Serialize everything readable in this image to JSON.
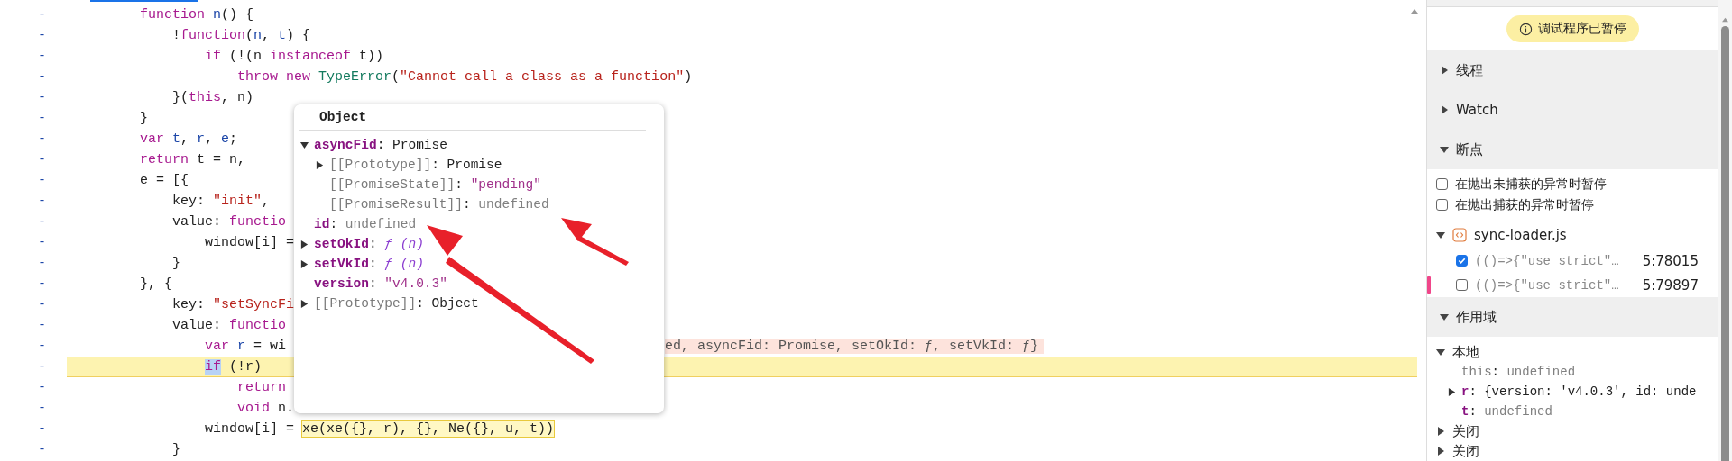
{
  "editor": {
    "lines": [
      {
        "gutter": "-",
        "paused": false,
        "tokens": [
          {
            "kind": "keyword",
            "text": "        function "
          },
          {
            "kind": "name",
            "text": "n"
          },
          {
            "kind": "plain",
            "text": "() {"
          }
        ]
      },
      {
        "gutter": "-",
        "paused": false,
        "tokens": [
          {
            "kind": "plain",
            "text": "            !"
          },
          {
            "kind": "keyword",
            "text": "function"
          },
          {
            "kind": "plain",
            "text": "("
          },
          {
            "kind": "name",
            "text": "n"
          },
          {
            "kind": "plain",
            "text": ", "
          },
          {
            "kind": "name",
            "text": "t"
          },
          {
            "kind": "plain",
            "text": ") {"
          }
        ]
      },
      {
        "gutter": "-",
        "paused": false,
        "tokens": [
          {
            "kind": "keyword",
            "text": "                if"
          },
          {
            "kind": "plain",
            "text": " (!(n "
          },
          {
            "kind": "keyword",
            "text": "instanceof"
          },
          {
            "kind": "plain",
            "text": " t))"
          }
        ]
      },
      {
        "gutter": "-",
        "paused": false,
        "tokens": [
          {
            "kind": "keyword",
            "text": "                    throw new "
          },
          {
            "kind": "type",
            "text": "TypeError"
          },
          {
            "kind": "plain",
            "text": "("
          },
          {
            "kind": "string",
            "text": "\"Cannot call a class as a function\""
          },
          {
            "kind": "plain",
            "text": ")"
          }
        ]
      },
      {
        "gutter": "-",
        "paused": false,
        "tokens": [
          {
            "kind": "plain",
            "text": "            }("
          },
          {
            "kind": "keyword",
            "text": "this"
          },
          {
            "kind": "plain",
            "text": ", n)"
          }
        ]
      },
      {
        "gutter": "-",
        "paused": false,
        "tokens": [
          {
            "kind": "plain",
            "text": "        }"
          }
        ]
      },
      {
        "gutter": "-",
        "paused": false,
        "tokens": [
          {
            "kind": "keyword",
            "text": "        var "
          },
          {
            "kind": "name",
            "text": "t"
          },
          {
            "kind": "plain",
            "text": ", "
          },
          {
            "kind": "name",
            "text": "r"
          },
          {
            "kind": "plain",
            "text": ", "
          },
          {
            "kind": "name",
            "text": "e"
          },
          {
            "kind": "plain",
            "text": ";"
          }
        ]
      },
      {
        "gutter": "-",
        "paused": false,
        "tokens": [
          {
            "kind": "keyword",
            "text": "        return"
          },
          {
            "kind": "plain",
            "text": " t = n,"
          }
        ]
      },
      {
        "gutter": "-",
        "paused": false,
        "tokens": [
          {
            "kind": "plain",
            "text": "        e = [{"
          }
        ]
      },
      {
        "gutter": "-",
        "paused": false,
        "tokens": [
          {
            "kind": "plain",
            "text": "            key: "
          },
          {
            "kind": "string",
            "text": "\"init\""
          },
          {
            "kind": "plain",
            "text": ","
          }
        ]
      },
      {
        "gutter": "-",
        "paused": false,
        "tokens": [
          {
            "kind": "plain",
            "text": "            value: "
          },
          {
            "kind": "keyword",
            "text": "functio"
          }
        ]
      },
      {
        "gutter": "-",
        "paused": false,
        "tokens": [
          {
            "kind": "plain",
            "text": "                window[i] ="
          }
        ]
      },
      {
        "gutter": "-",
        "paused": false,
        "tokens": [
          {
            "kind": "plain",
            "text": "            }"
          }
        ]
      },
      {
        "gutter": "-",
        "paused": false,
        "tokens": [
          {
            "kind": "plain",
            "text": "        }, {"
          }
        ]
      },
      {
        "gutter": "-",
        "paused": false,
        "tokens": [
          {
            "kind": "plain",
            "text": "            key: "
          },
          {
            "kind": "string",
            "text": "\"setSyncFi"
          }
        ]
      },
      {
        "gutter": "-",
        "paused": false,
        "tokens": [
          {
            "kind": "plain",
            "text": "            value: "
          },
          {
            "kind": "keyword",
            "text": "functio"
          }
        ]
      },
      {
        "gutter": "-",
        "paused": false,
        "tokens": [
          {
            "kind": "keyword",
            "text": "                var "
          },
          {
            "kind": "name",
            "text": "r"
          },
          {
            "kind": "plain",
            "text": " = wi"
          }
        ],
        "inline_value": "ed, asyncFid: Promise, setOkId: ƒ, setVkId: ƒ}"
      },
      {
        "gutter": "-",
        "paused": true,
        "tokens": [
          {
            "kind": "selection",
            "text": "                if"
          },
          {
            "kind": "plain",
            "text": " (!r)"
          }
        ]
      },
      {
        "gutter": "-",
        "paused": false,
        "tokens": [
          {
            "kind": "keyword",
            "text": "                    return"
          }
        ]
      },
      {
        "gutter": "-",
        "paused": false,
        "tokens": [
          {
            "kind": "keyword",
            "text": "                    void"
          },
          {
            "kind": "plain",
            "text": " n."
          }
        ]
      },
      {
        "gutter": "-",
        "paused": false,
        "tokens": [
          {
            "kind": "plain",
            "text": "                window[i] = "
          },
          {
            "kind": "boxed",
            "text": "xe(xe({}, r), {}, Ne({}, u, t))"
          }
        ]
      },
      {
        "gutter": "-",
        "paused": false,
        "tokens": [
          {
            "kind": "plain",
            "text": "            }"
          }
        ]
      }
    ]
  },
  "popover": {
    "title": "Object",
    "items": [
      {
        "kind": "property",
        "key": "asyncFid:",
        "value": {
          "kind": "plain",
          "text": "Promise"
        },
        "expanded": true,
        "children": [
          {
            "kind": "internal",
            "key": "[[Prototype]]:",
            "value": {
              "kind": "plain",
              "text": "Promise"
            },
            "expanded": false
          },
          {
            "kind": "internal",
            "key": "[[PromiseState]]:",
            "value": {
              "kind": "string",
              "text": "\"pending\""
            }
          },
          {
            "kind": "internal",
            "key": "[[PromiseResult]]:",
            "value": {
              "kind": "undefined",
              "text": "undefined"
            }
          }
        ]
      },
      {
        "kind": "property",
        "key": "id:",
        "value": {
          "kind": "undefined",
          "text": "undefined"
        }
      },
      {
        "kind": "property",
        "key": "setOkId:",
        "value": {
          "kind": "function",
          "text": "ƒ (n)"
        },
        "expanded": false
      },
      {
        "kind": "property",
        "key": "setVkId:",
        "value": {
          "kind": "function",
          "text": "ƒ (n)"
        },
        "expanded": false
      },
      {
        "kind": "property",
        "key": "version:",
        "value": {
          "kind": "string",
          "text": "\"v4.0.3\""
        }
      },
      {
        "kind": "internal",
        "key": "[[Prototype]]:",
        "value": {
          "kind": "plain",
          "text": "Object"
        },
        "expanded": false
      }
    ]
  },
  "debugger": {
    "paused_badge": "调试程序已暂停",
    "sections": [
      {
        "title": "线程",
        "expanded": false
      },
      {
        "title": "Watch",
        "expanded": false
      },
      {
        "title": "断点",
        "expanded": true
      }
    ],
    "exception_options": [
      {
        "label": "在抛出未捕获的异常时暂停",
        "checked": false
      },
      {
        "label": "在抛出捕获的异常时暂停",
        "checked": false
      }
    ],
    "breakpoint_file": {
      "name": "sync-loader.js",
      "expanded": true,
      "breakpoints": [
        {
          "code": "(()=>{\"use strict\"…",
          "location": "5:78015",
          "checked": true,
          "hit": false
        },
        {
          "code": "(()=>{\"use strict\"…",
          "location": "5:79897",
          "checked": false,
          "hit": true
        }
      ]
    },
    "scope": {
      "title": "作用域",
      "expanded": true,
      "groups": [
        {
          "label": "本地",
          "expanded": true,
          "children": [
            {
              "kind": "internal",
              "key": "this:",
              "value": {
                "kind": "undefined",
                "text": "undefined"
              }
            },
            {
              "kind": "property",
              "key": "r:",
              "value": {
                "kind": "plain",
                "text": "{version: 'v4.0.3', id: unde"
              },
              "expanded": false
            },
            {
              "kind": "property",
              "key": "t:",
              "value": {
                "kind": "undefined",
                "text": "undefined"
              }
            }
          ]
        },
        {
          "label": "关闭",
          "expanded": false
        },
        {
          "label": "关闭",
          "expanded": false
        }
      ]
    }
  }
}
